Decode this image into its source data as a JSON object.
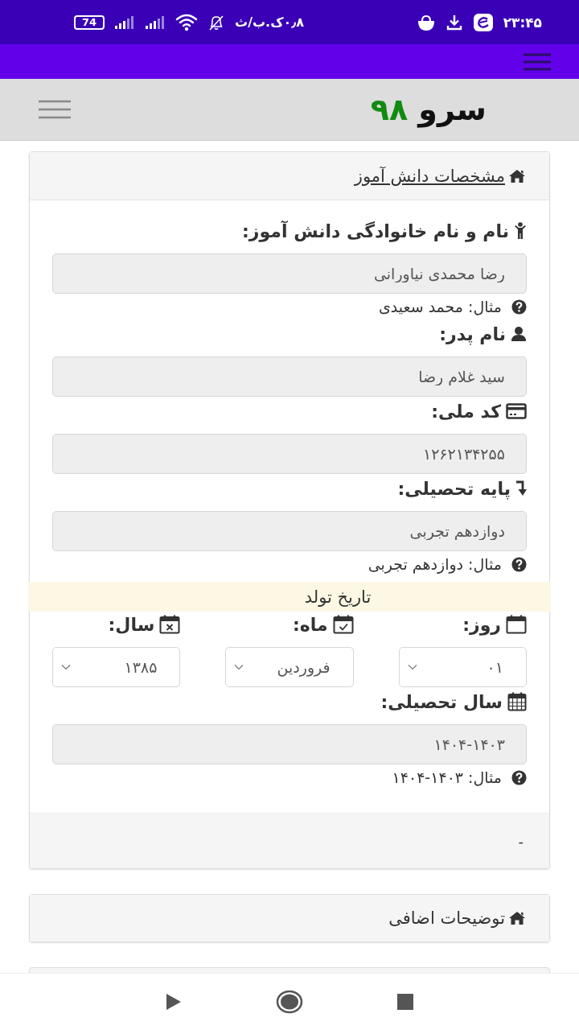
{
  "status_bar": {
    "time": "۲۳:۴۵",
    "speed": "۰٫۸ک.ب/ث",
    "battery": "74"
  },
  "header": {
    "logo_word": "سرو",
    "logo_number": "۹۸"
  },
  "student_card": {
    "title": "مشخصات دانش آموز",
    "rows": [
      {
        "kind": "field",
        "label": "نام و نام خانوادگی دانش آموز:",
        "value": "رضا محمدی نیاورانی",
        "hint": "مثال: محمد سعیدی"
      },
      {
        "kind": "field",
        "label": "نام پدر:",
        "value": "سید غلام رضا"
      },
      {
        "kind": "field",
        "label": "کد ملی:",
        "value": "۱۲۶۲۱۳۴۲۵۵"
      },
      {
        "kind": "field",
        "label": "پایه تحصیلی:",
        "value": "دوازدهم تجربی",
        "hint": "مثال: دوازدهم تجربی"
      },
      {
        "kind": "band",
        "text": "تاریخ تولد"
      },
      {
        "kind": "selects",
        "items": [
          {
            "label": "روز:",
            "value": "۰۱"
          },
          {
            "label": "ماه:",
            "value": "فروردین"
          },
          {
            "label": "سال:",
            "value": "۱۳۸۵"
          }
        ]
      },
      {
        "kind": "field",
        "label": "سال تحصیلی:",
        "value": "۱۴۰۴-۱۴۰۳",
        "hint": "مثال: ۱۴۰۳-۱۴۰۴"
      }
    ],
    "footer": "-"
  },
  "notes_card": {
    "title": "توضیحات اضافی"
  }
}
